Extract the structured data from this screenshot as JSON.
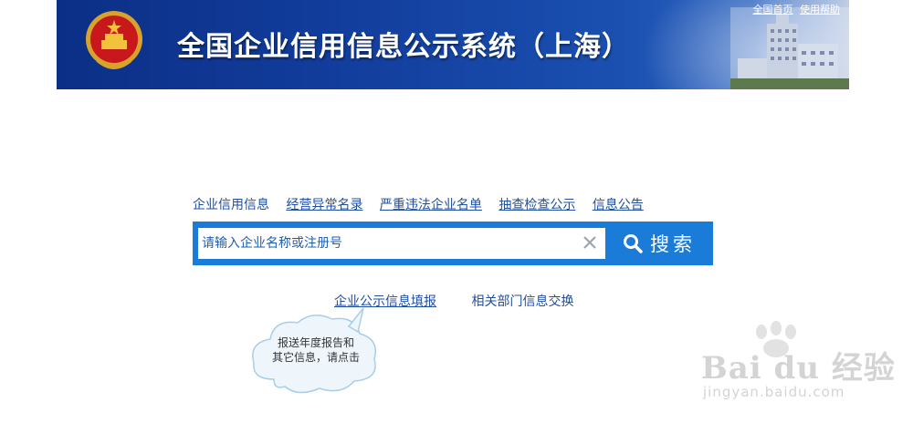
{
  "header": {
    "title": "全国企业信用信息公示系统（上海）",
    "top_links": [
      "全国首页",
      "使用帮助"
    ]
  },
  "tabs": [
    {
      "label": "企业信用信息"
    },
    {
      "label": "经营异常名录"
    },
    {
      "label": "严重违法企业名单"
    },
    {
      "label": "抽查检查公示"
    },
    {
      "label": "信息公告"
    }
  ],
  "search": {
    "placeholder": "请输入企业名称或注册号",
    "value": "",
    "button_label": "搜索"
  },
  "links": {
    "report": "企业公示信息填报",
    "exchange": "相关部门信息交换"
  },
  "tooltip": {
    "line1": "报送年度报告和",
    "line2": "其它信息，请点击"
  },
  "watermark": {
    "brand": "Bai du 经验",
    "url": "jingyan.baidu.com"
  },
  "colors": {
    "banner": "#123d9c",
    "search_bg": "#1a7bd8",
    "link": "#1f4fa0"
  }
}
